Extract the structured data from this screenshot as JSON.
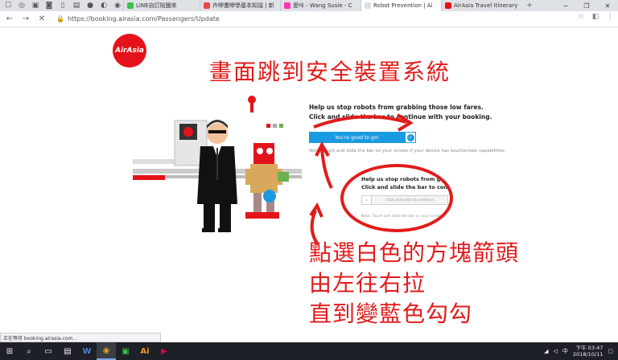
{
  "tabs": [
    {
      "label": "LINE自訂貼圖來",
      "color": "#3ac34a"
    },
    {
      "label": "卉咿畫咿學基本知識 | 新",
      "color": "#e44"
    },
    {
      "label": "愛咔 - Wang Susie - C",
      "color": "#f3b"
    },
    {
      "label": "Robot Prevention | Ai",
      "color": "#ddd"
    },
    {
      "label": "AirAsia Travel Itinerary",
      "color": "#e4121b"
    }
  ],
  "url": "https://booking.airasia.com/Passengers/Update",
  "logo_text": "AirAsia",
  "annotation_top": "畫面跳到安全裝置系統",
  "annotation_bottom": [
    "點選白色的方塊箭頭",
    "由左往右拉",
    "直到變藍色勾勾"
  ],
  "robot": {
    "line1": "Help us stop robots from grabbing those low fares.",
    "line2": "Click and slide the bar to continue with your booking.",
    "slider_label": "You're good to go!",
    "note": "Note: Touch and slide the bar on your screen if your device has touchscreen capabilities."
  },
  "zoom": {
    "line1": "Help us stop robots from grab",
    "line2": "Click and slide the bar to continue",
    "slider_label": "Click and slide to continue",
    "note": "Note: Touch and slide the bar on your screen"
  },
  "status_text": "正在等待 booking.airasia.com...",
  "clock": {
    "time": "下午 03:47",
    "date": "2018/10/11"
  },
  "colors": {
    "accent": "#1a9ae0",
    "annotation": "#e21b1b",
    "brand": "#e4121b"
  }
}
